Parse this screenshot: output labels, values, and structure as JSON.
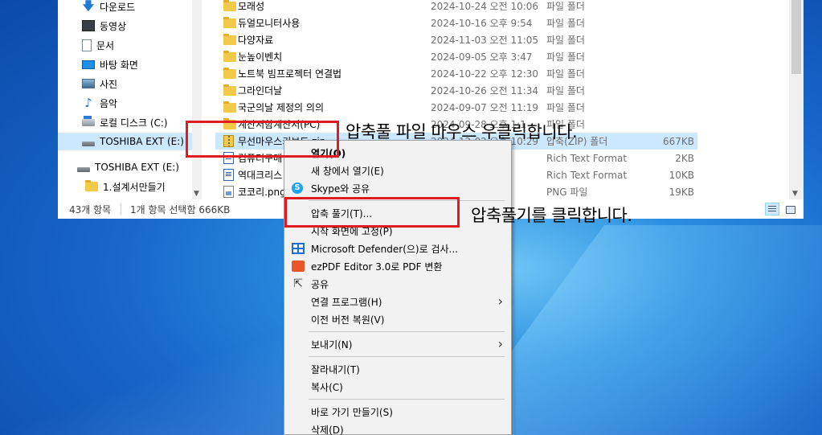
{
  "explorer": {
    "nav_items": [
      {
        "label": "다운로드",
        "icon": "download-arrow-icon"
      },
      {
        "label": "동영상",
        "icon": "video-icon"
      },
      {
        "label": "문서",
        "icon": "document-icon"
      },
      {
        "label": "바탕 화면",
        "icon": "desktop-icon"
      },
      {
        "label": "사진",
        "icon": "pictures-icon"
      },
      {
        "label": "음악",
        "icon": "music-icon"
      },
      {
        "label": "로컬 디스크 (C:)",
        "icon": "local-disk-icon"
      },
      {
        "label": "TOSHIBA EXT (E:)",
        "icon": "drive-icon"
      },
      {
        "label": "TOSHIBA EXT (E:)",
        "icon": "drive-icon"
      },
      {
        "label": "1.설계서만들기",
        "icon": "folder-icon"
      }
    ],
    "files": [
      {
        "name": "모래성",
        "date": "2024-10-24 오전 10:06",
        "type": "파일 폴더",
        "size": "",
        "icon": "folder-icon"
      },
      {
        "name": "듀얼모니터사용",
        "date": "2024-10-16 오후 9:54",
        "type": "파일 폴더",
        "size": "",
        "icon": "folder-icon"
      },
      {
        "name": "다양자료",
        "date": "2024-11-03 오전 11:05",
        "type": "파일 폴더",
        "size": "",
        "icon": "folder-icon"
      },
      {
        "name": "눈높이벤치",
        "date": "2024-09-05 오후 3:47",
        "type": "파일 폴더",
        "size": "",
        "icon": "folder-icon"
      },
      {
        "name": "노트북 빔프로젝터 연결법",
        "date": "2024-10-22 오후 12:30",
        "type": "파일 폴더",
        "size": "",
        "icon": "folder-icon"
      },
      {
        "name": "그라인더날",
        "date": "2024-10-26 오전 11:34",
        "type": "파일 폴더",
        "size": "",
        "icon": "folder-icon"
      },
      {
        "name": "국군의날 제정의 의의",
        "date": "2024-09-07 오전 11:19",
        "type": "파일 폴더",
        "size": "",
        "icon": "folder-icon"
      },
      {
        "name": "계산서함계산서(PC)",
        "date": "2024-09-28 오후 1:1",
        "type": "파일 폴더",
        "size": "",
        "icon": "folder-icon"
      },
      {
        "name": "무선마우스키보드.zip",
        "date": "2024-12-02 오후 10:29",
        "type": "압축(ZIP) 폴더",
        "size": "667KB",
        "icon": "zip-icon"
      },
      {
        "name": "컴퓨터구매",
        "date": "4:27",
        "type": "Rich Text Format",
        "size": "2KB",
        "icon": "rtf-icon"
      },
      {
        "name": "역대크리스",
        "date": "2:57",
        "type": "Rich Text Format",
        "size": "10KB",
        "icon": "rtf-icon"
      },
      {
        "name": "코코리.png",
        "date": "3:24",
        "type": "PNG 파일",
        "size": "19KB",
        "icon": "png-icon"
      }
    ],
    "status": {
      "count": "43개 항목",
      "selection": "1개 항목 선택함 666KB"
    }
  },
  "context_menu": {
    "items": [
      {
        "label": "열기(O)",
        "bold": true,
        "icon": "",
        "submenu": false
      },
      {
        "label": "새 창에서 열기(E)",
        "bold": false,
        "icon": "",
        "submenu": false
      },
      {
        "label": "Skype와 공유",
        "bold": false,
        "icon": "skype-icon",
        "submenu": false
      },
      {
        "separator": true
      },
      {
        "label": "압축 풀기(T)...",
        "bold": false,
        "icon": "",
        "submenu": false
      },
      {
        "label": "시작 화면에 고정(P)",
        "bold": false,
        "icon": "",
        "submenu": false
      },
      {
        "label": "Microsoft Defender(으)로 검사...",
        "bold": false,
        "icon": "defender-icon",
        "submenu": false
      },
      {
        "label": "ezPDF Editor 3.0로 PDF 변환",
        "bold": false,
        "icon": "ezpdf-icon",
        "submenu": false
      },
      {
        "label": "공유",
        "bold": false,
        "icon": "share-icon",
        "submenu": false
      },
      {
        "label": "연결 프로그램(H)",
        "bold": false,
        "icon": "",
        "submenu": true
      },
      {
        "label": "이전 버전 복원(V)",
        "bold": false,
        "icon": "",
        "submenu": false
      },
      {
        "separator": true
      },
      {
        "label": "보내기(N)",
        "bold": false,
        "icon": "",
        "submenu": true
      },
      {
        "separator": true
      },
      {
        "label": "잘라내기(T)",
        "bold": false,
        "icon": "",
        "submenu": false
      },
      {
        "label": "복사(C)",
        "bold": false,
        "icon": "",
        "submenu": false
      },
      {
        "separator": true
      },
      {
        "label": "바로 가기 만들기(S)",
        "bold": false,
        "icon": "",
        "submenu": false
      },
      {
        "label": "삭제(D)",
        "bold": false,
        "icon": "",
        "submenu": false
      }
    ]
  },
  "annotations": {
    "step1": "압축풀 파일 마우스 우클릭합니다.",
    "step2": "압축풀기를 클릭합니다."
  },
  "colors": {
    "annotation_red": "#e01b22",
    "selection_blue": "#cce8ff",
    "desktop_blue": "#1766c9"
  }
}
